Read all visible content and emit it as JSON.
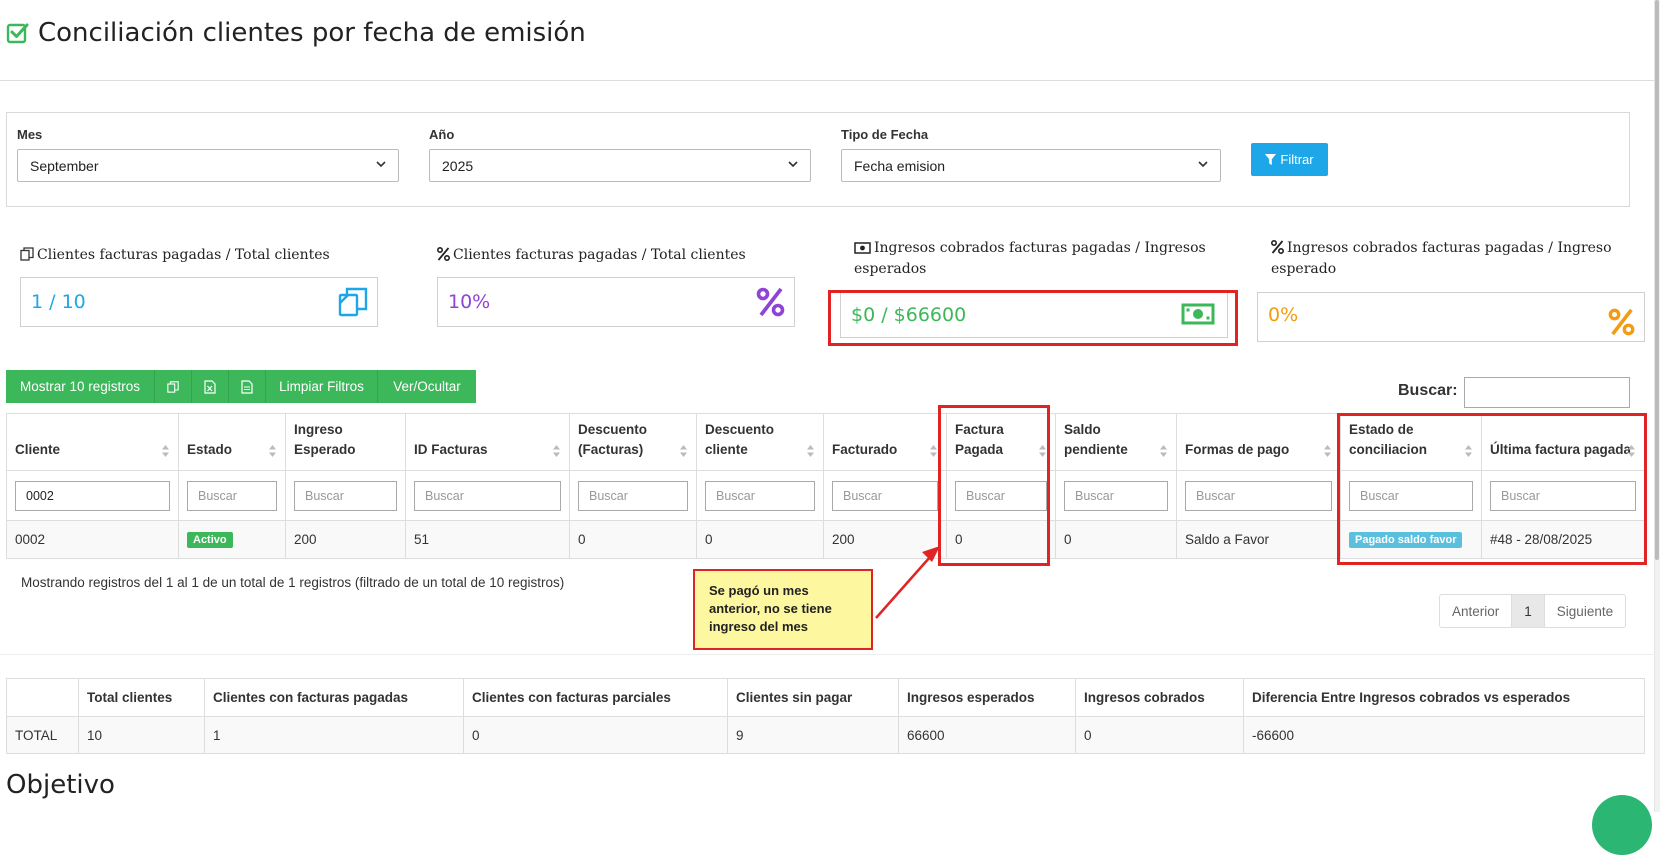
{
  "page": {
    "title": "Conciliación clientes por fecha de emisión",
    "section_heading": "Objetivo"
  },
  "filters": {
    "month": {
      "label": "Mes",
      "value": "September"
    },
    "year": {
      "label": "Año",
      "value": "2025"
    },
    "date_type": {
      "label": "Tipo de Fecha",
      "value": "Fecha emision"
    },
    "filter_button": "Filtrar"
  },
  "stats": [
    {
      "label": "Clientes facturas pagadas / Total clientes",
      "value": "1 / 10",
      "color": "#1ea7e8",
      "icon": "copy-icon"
    },
    {
      "label": "Clientes facturas pagadas / Total clientes",
      "value": "10%",
      "color": "#8e44d4",
      "icon": "percent-icon"
    },
    {
      "label": "Ingresos cobrados facturas pagadas / Ingresos esperados",
      "value": "$0 / $66600",
      "color": "#3cb75a",
      "icon": "money-icon"
    },
    {
      "label": "Ingresos cobrados facturas pagadas / Ingreso esperado",
      "value": "0%",
      "color": "#f39c12",
      "icon": "percent-icon"
    }
  ],
  "toolbar": {
    "show_records": "Mostrar 10 registros",
    "clear_filters": "Limpiar Filtros",
    "toggle_columns": "Ver/Ocultar"
  },
  "search": {
    "label": "Buscar:",
    "value": ""
  },
  "table": {
    "columns": [
      "Cliente",
      "Estado",
      "Ingreso Esperado",
      "ID Facturas",
      "Descuento (Facturas)",
      "Descuento cliente",
      "Facturado",
      "Factura Pagada",
      "Saldo pendiente",
      "Formas de pago",
      "Estado de conciliacion",
      "Última factura pagada"
    ],
    "filter_placeholder": "Buscar",
    "client_filter_value": "0002",
    "rows": [
      {
        "cliente": "0002",
        "estado": "Activo",
        "ingreso_esperado": "200",
        "id_facturas": "51",
        "descuento_facturas": "0",
        "descuento_cliente": "0",
        "facturado": "200",
        "factura_pagada": "0",
        "saldo_pendiente": "0",
        "formas_pago": "Saldo a Favor",
        "estado_conciliacion": "Pagado saldo favor",
        "ultima_factura": "#48 - 28/08/2025"
      }
    ],
    "status_colors": {
      "activo": "#3cb75a",
      "pagado_saldo_favor": "#5bc0de"
    }
  },
  "records_info": "Mostrando registros del 1 al 1 de un total de 1 registros (filtrado de un total de 10 registros)",
  "pagination": {
    "previous": "Anterior",
    "current": "1",
    "next": "Siguiente"
  },
  "callout": {
    "text": "Se pagó un mes anterior, no se tiene ingreso del mes"
  },
  "totals": {
    "columns": [
      "",
      "Total clientes",
      "Clientes con facturas pagadas",
      "Clientes con facturas parciales",
      "Clientes sin pagar",
      "Ingresos esperados",
      "Ingresos cobrados",
      "Diferencia Entre Ingresos cobrados vs esperados"
    ],
    "row": [
      "TOTAL",
      "10",
      "1",
      "0",
      "9",
      "66600",
      "0",
      "-66600"
    ]
  },
  "colors": {
    "accent": "#1ea7e8",
    "success": "#3cb75a",
    "highlight": "#e02424",
    "callout_bg": "#fdf79f"
  }
}
